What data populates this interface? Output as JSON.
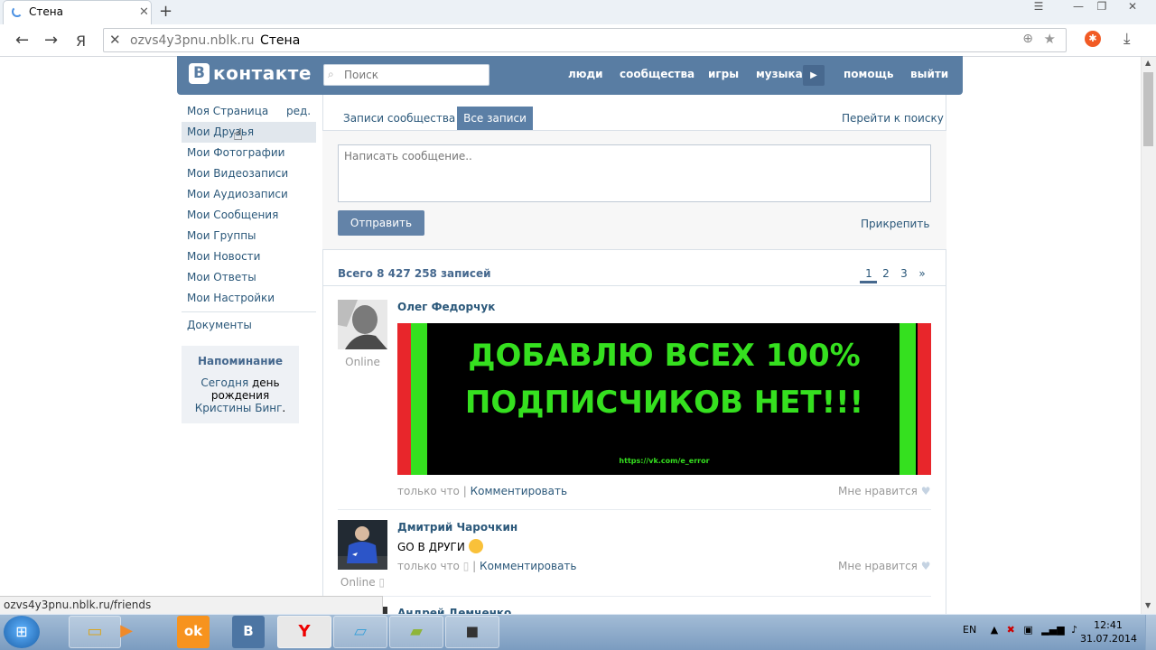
{
  "browser": {
    "tab_title": "Стена",
    "url_host": "ozvs4y3pnu.nblk.ru",
    "page_title": "Стена",
    "status_url": "ozvs4y3pnu.nblk.ru/friends",
    "ya_label": "Я"
  },
  "vk": {
    "logo_letter": "В",
    "logo_text": "контакте",
    "search_placeholder": "Поиск",
    "nav": [
      "люди",
      "сообщества",
      "игры",
      "музыка",
      "помощь",
      "выйти"
    ]
  },
  "left_menu": {
    "items": [
      "Моя Страница",
      "Мои Друзья",
      "Мои Фотографии",
      "Мои Видеозаписи",
      "Мои Аудиозаписи",
      "Мои Сообщения",
      "Мои Группы",
      "Мои Новости",
      "Мои Ответы",
      "Мои Настройки"
    ],
    "edit": "ред.",
    "documents": "Документы",
    "reminder_title": "Напоминание",
    "reminder_today": "Сегодня",
    "reminder_day": "день рождения",
    "reminder_name": "Кристины Бинг",
    "reminder_dot": "."
  },
  "wall": {
    "tab_community": "Записи сообщества",
    "tab_all": "Все записи",
    "go_search": "Перейти к поиску",
    "placeholder": "Написать сообщение..",
    "send": "Отправить",
    "attach": "Прикрепить",
    "total": "Всего 8 427 258 записей",
    "pages": [
      "1",
      "2",
      "3",
      "»"
    ]
  },
  "posts": [
    {
      "author": "Олег Федорчук",
      "status": "Online",
      "banner_line1": "ДОБАВЛЮ ВСЕХ 100%",
      "banner_line2": "ПОДПИСЧИКОВ НЕТ!!!",
      "banner_url": "https://vk.com/e_error",
      "time": "только что",
      "sep": "|",
      "comment": "Комментировать",
      "like": "Мне нравится"
    },
    {
      "author": "Дмитрий Чарочкин",
      "status": "Online",
      "text": "GO В ДРУГИ",
      "time": "только что",
      "sep": "|",
      "comment": "Комментировать",
      "like": "Мне нравится"
    },
    {
      "author": "Андрей Демченко"
    }
  ],
  "taskbar": {
    "lang": "EN",
    "time": "12:41",
    "date": "31.07.2014"
  }
}
